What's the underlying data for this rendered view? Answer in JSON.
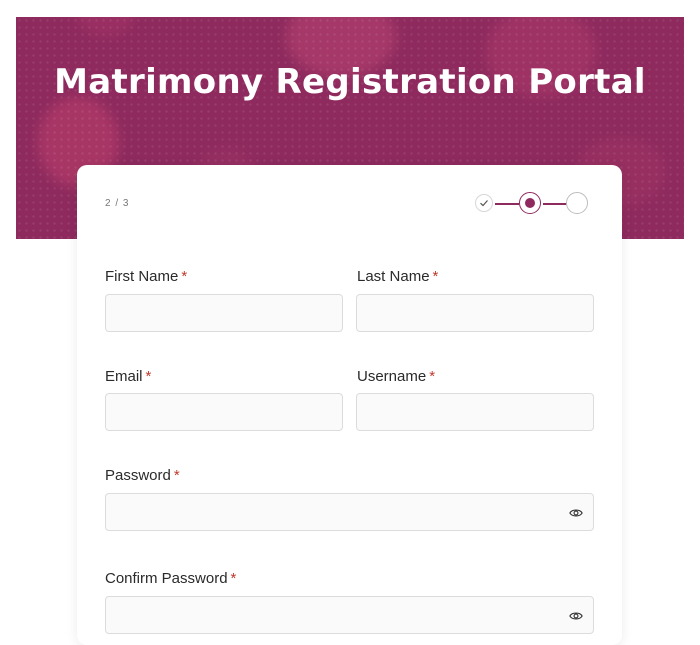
{
  "header": {
    "title": "Matrimony Registration Portal"
  },
  "form": {
    "step_indicator": "2 / 3",
    "fields": {
      "first_name": {
        "label": "First Name",
        "required": "*",
        "value": ""
      },
      "last_name": {
        "label": "Last Name",
        "required": "*",
        "value": ""
      },
      "email": {
        "label": "Email",
        "required": "*",
        "value": ""
      },
      "username": {
        "label": "Username",
        "required": "*",
        "value": ""
      },
      "password": {
        "label": "Password",
        "required": "*",
        "value": "",
        "icon": "eye-icon"
      },
      "confirm_password": {
        "label": "Confirm Password",
        "required": "*",
        "value": "",
        "icon": "eye-icon"
      }
    }
  },
  "colors": {
    "brand": "#8e2a5e",
    "required": "#c0392b"
  }
}
